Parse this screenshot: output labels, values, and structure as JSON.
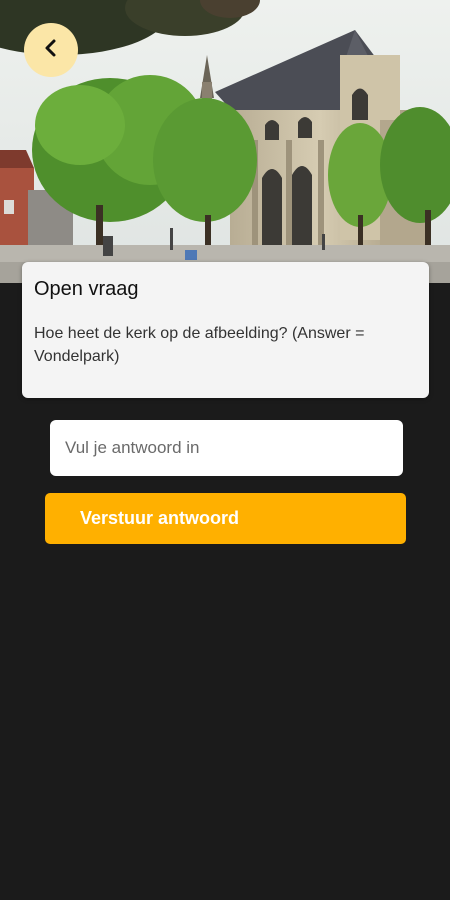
{
  "header": {
    "back_icon": "chevron-left-icon",
    "back_button_color": "#fbe6a7"
  },
  "question_card": {
    "title": "Open vraag",
    "question": "Hoe heet de kerk op de afbeelding? (Answer = Vondelpark)"
  },
  "answer": {
    "placeholder": "Vul je antwoord in",
    "value": ""
  },
  "submit": {
    "label": "Verstuur antwoord",
    "color": "#ffb000"
  },
  "colors": {
    "background": "#1b1b1b",
    "card": "#f4f4f4"
  }
}
